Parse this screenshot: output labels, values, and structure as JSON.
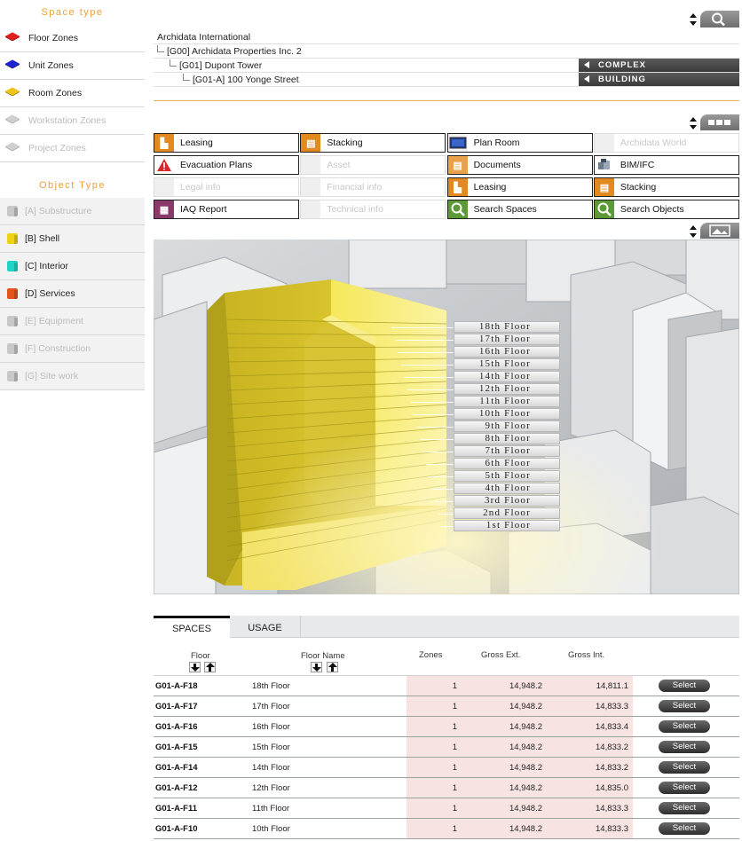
{
  "sidebar": {
    "space_type_heading": "Space type",
    "space_types": [
      {
        "label": "Floor Zones",
        "color": "red",
        "enabled": true
      },
      {
        "label": "Unit Zones",
        "color": "blue",
        "enabled": true
      },
      {
        "label": "Room Zones",
        "color": "yellow",
        "enabled": true
      },
      {
        "label": "Workstation Zones",
        "color": "grey",
        "enabled": false
      },
      {
        "label": "Project Zones",
        "color": "grey",
        "enabled": false
      }
    ],
    "object_type_heading": "Object Type",
    "object_types": [
      {
        "label": "[A] Substructure",
        "color": "grey",
        "enabled": false
      },
      {
        "label": "[B] Shell",
        "color": "yellow",
        "enabled": true
      },
      {
        "label": "[C] Interior",
        "color": "cyan",
        "enabled": true
      },
      {
        "label": "[D] Services",
        "color": "orange",
        "enabled": true
      },
      {
        "label": "[E] Equipment",
        "color": "grey",
        "enabled": false
      },
      {
        "label": "[F] Construction",
        "color": "grey",
        "enabled": false
      },
      {
        "label": "[G] Site work",
        "color": "grey",
        "enabled": false
      }
    ]
  },
  "tree": {
    "root": "Archidata International",
    "level1": "[G00] Archidata Properties Inc. 2",
    "level2": "[G01] Dupont Tower",
    "level3": "[G01-A] 100 Yonge Street",
    "complex_label": "COMPLEX",
    "building_label": "BUILDING"
  },
  "grid": [
    {
      "label": "Leasing",
      "icon": "leasing-icon",
      "enabled": true
    },
    {
      "label": "Stacking",
      "icon": "stacking-icon",
      "enabled": true
    },
    {
      "label": "Plan Room",
      "icon": "plan-room-icon",
      "enabled": true
    },
    {
      "label": "Archidata World",
      "icon": "world-icon",
      "enabled": false
    },
    {
      "label": "Evacuation Plans",
      "icon": "warning-icon",
      "enabled": true
    },
    {
      "label": "Asset",
      "icon": "asset-icon",
      "enabled": false
    },
    {
      "label": "Documents",
      "icon": "documents-icon",
      "enabled": true
    },
    {
      "label": "BIM/IFC",
      "icon": "bim-icon",
      "enabled": true
    },
    {
      "label": "Legal info",
      "icon": "legal-icon",
      "enabled": false
    },
    {
      "label": "Financial info",
      "icon": "financial-icon",
      "enabled": false
    },
    {
      "label": "Leasing",
      "icon": "leasing-icon",
      "enabled": true
    },
    {
      "label": "Stacking",
      "icon": "stacking-icon",
      "enabled": true
    },
    {
      "label": "IAQ Report",
      "icon": "iaq-report-icon",
      "enabled": true
    },
    {
      "label": "Technical info",
      "icon": "technical-icon",
      "enabled": false
    },
    {
      "label": "Search Spaces",
      "icon": "search-icon",
      "enabled": true
    },
    {
      "label": "Search Objects",
      "icon": "search-icon",
      "enabled": true
    }
  ],
  "floors": [
    "18th Floor",
    "17th Floor",
    "16th Floor",
    "15th Floor",
    "14th Floor",
    "12th Floor",
    "11th Floor",
    "10th Floor",
    "9th Floor",
    "8th Floor",
    "7th Floor",
    "6th Floor",
    "5th Floor",
    "4th Floor",
    "3rd Floor",
    "2nd Floor",
    "1st Floor"
  ],
  "tabs": {
    "spaces": "SPACES",
    "usage": "USAGE"
  },
  "table": {
    "headers": {
      "floor": "Floor",
      "floor_name": "Floor Name",
      "zones": "Zones",
      "gross_ext": "Gross Ext.",
      "gross_int": "Gross Int."
    },
    "select_label": "Select",
    "rows": [
      {
        "id": "G01-A-F18",
        "name": "18th Floor",
        "zones": "1",
        "gross_ext": "14,948.2",
        "gross_int": "14,811.1"
      },
      {
        "id": "G01-A-F17",
        "name": "17th Floor",
        "zones": "1",
        "gross_ext": "14,948.2",
        "gross_int": "14,833.3"
      },
      {
        "id": "G01-A-F16",
        "name": "16th Floor",
        "zones": "1",
        "gross_ext": "14,948.2",
        "gross_int": "14,833.4"
      },
      {
        "id": "G01-A-F15",
        "name": "15th Floor",
        "zones": "1",
        "gross_ext": "14,948.2",
        "gross_int": "14,833.2"
      },
      {
        "id": "G01-A-F14",
        "name": "14th Floor",
        "zones": "1",
        "gross_ext": "14,948.2",
        "gross_int": "14,833.2"
      },
      {
        "id": "G01-A-F12",
        "name": "12th Floor",
        "zones": "1",
        "gross_ext": "14,948.2",
        "gross_int": "14,835.0"
      },
      {
        "id": "G01-A-F11",
        "name": "11th Floor",
        "zones": "1",
        "gross_ext": "14,948.2",
        "gross_int": "14,833.3"
      },
      {
        "id": "G01-A-F10",
        "name": "10th Floor",
        "zones": "1",
        "gross_ext": "14,948.2",
        "gross_int": "14,833.3"
      }
    ]
  }
}
